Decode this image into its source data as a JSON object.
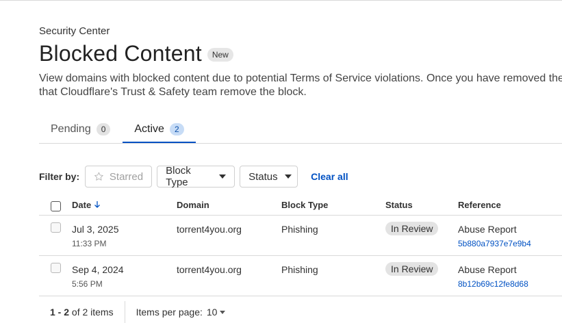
{
  "header": {
    "section": "Security Center",
    "title": "Blocked Content",
    "badge": "New",
    "description_line1": "View domains with blocked content due to potential Terms of Service violations. Once you have removed the",
    "description_line2": "that Cloudflare's Trust & Safety team remove the block."
  },
  "tabs": [
    {
      "label": "Pending",
      "count": "0"
    },
    {
      "label": "Active",
      "count": "2"
    }
  ],
  "filters": {
    "label": "Filter by:",
    "starred": "Starred",
    "block_type": "Block Type",
    "status": "Status",
    "clear_all": "Clear all"
  },
  "table": {
    "columns": [
      "Date",
      "Domain",
      "Block Type",
      "Status",
      "Reference"
    ],
    "rows": [
      {
        "date": "Jul 3, 2025",
        "time": "11:33 PM",
        "domain": "torrent4you.org",
        "block_type": "Phishing",
        "status": "In Review",
        "reference": "Abuse Report",
        "reference_id": "5b880a7937e7e9b4"
      },
      {
        "date": "Sep 4, 2024",
        "time": "5:56 PM",
        "domain": "torrent4you.org",
        "block_type": "Phishing",
        "status": "In Review",
        "reference": "Abuse Report",
        "reference_id": "8b12b69c12fe8d68"
      }
    ]
  },
  "pagination": {
    "range_bold": "1 - 2",
    "range_rest": " of 2 items",
    "items_per_page_label": "Items per page:",
    "items_per_page_value": "10"
  },
  "colors": {
    "accent": "#0051c3",
    "pill": "#e3e3e3",
    "border": "#d9d9d9"
  }
}
